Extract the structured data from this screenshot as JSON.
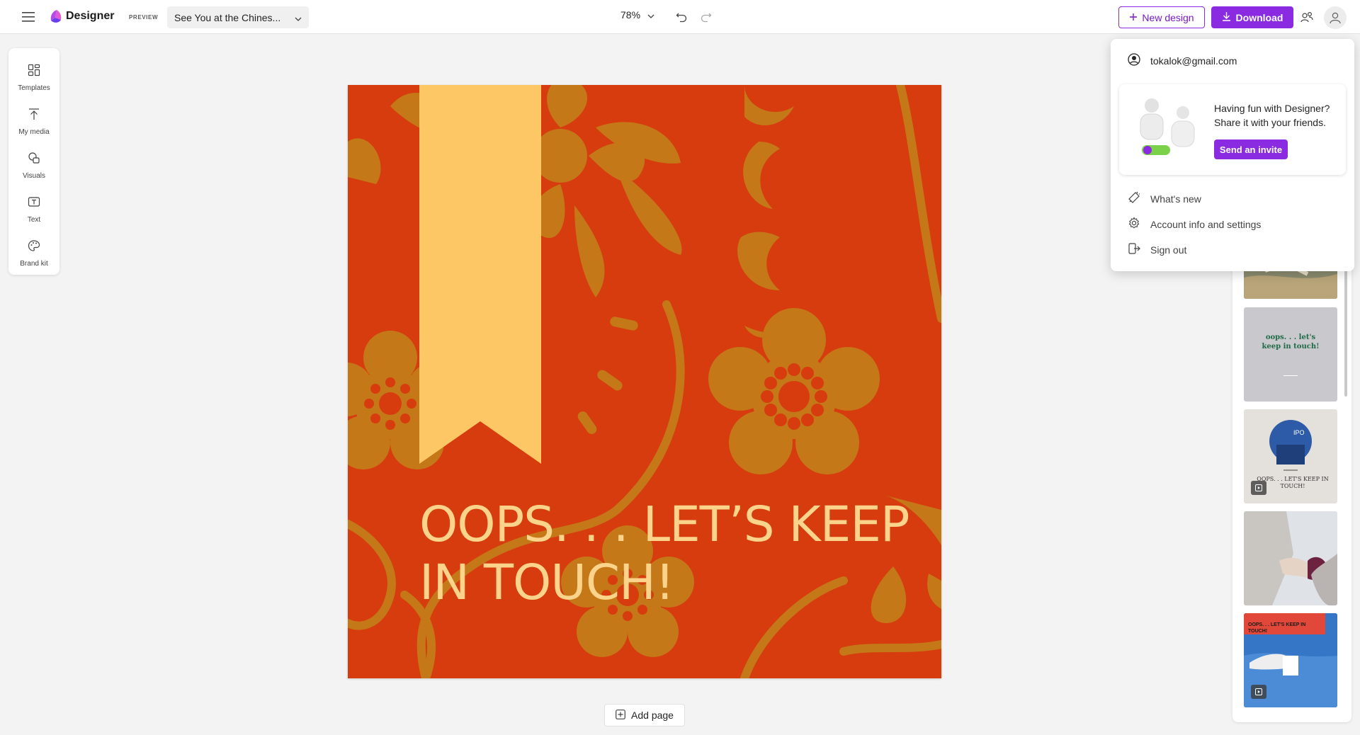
{
  "app": {
    "name": "Designer",
    "preview_badge": "PREVIEW"
  },
  "header": {
    "document_title": "See You at the Chines...",
    "zoom": "78%",
    "new_design_label": "New design",
    "download_label": "Download"
  },
  "left_rail": {
    "items": [
      {
        "label": "Templates",
        "icon": "templates-icon"
      },
      {
        "label": "My media",
        "icon": "upload-icon"
      },
      {
        "label": "Visuals",
        "icon": "visuals-icon"
      },
      {
        "label": "Text",
        "icon": "text-icon"
      },
      {
        "label": "Brand kit",
        "icon": "palette-icon"
      }
    ]
  },
  "canvas": {
    "headline_line1": "OOPS. . . LET’S KEEP",
    "headline_line2": "IN TOUCH!",
    "background_color": "#d63c0e",
    "pattern_color": "#c57818",
    "ribbon_color": "#fdc765",
    "text_color": "#fcd38a"
  },
  "add_page_label": "Add page",
  "thumbnails": [
    {
      "text": "oops. . . let's keep in touch!"
    },
    {
      "text": "OOPS. . . LET'S KEEP IN TOUCH!"
    },
    {
      "text": "OOPS. . . LET'S KEEP IN TOUCH!"
    }
  ],
  "account_menu": {
    "email": "tokalok@gmail.com",
    "invite_line1": "Having fun with Designer?",
    "invite_line2": "Share it with your friends.",
    "send_invite_label": "Send an invite",
    "items": [
      {
        "label": "What's new",
        "icon": "megaphone-icon"
      },
      {
        "label": "Account info and settings",
        "icon": "gear-icon"
      },
      {
        "label": "Sign out",
        "icon": "sign-out-icon"
      }
    ]
  },
  "colors": {
    "accent": "#8a2be2",
    "accent_text": "#7719c9"
  }
}
